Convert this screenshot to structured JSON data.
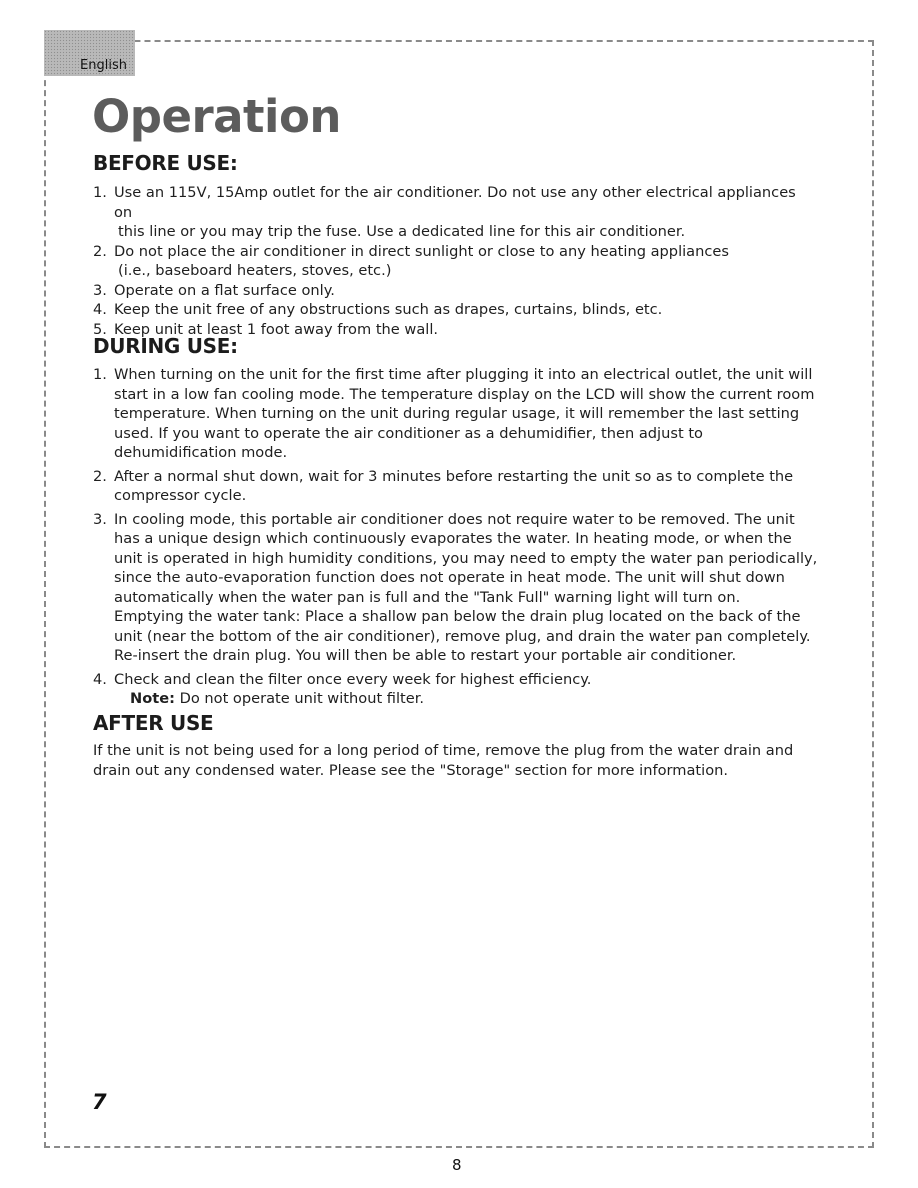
{
  "header": {
    "language_tab": "English",
    "title": "Operation"
  },
  "sections": {
    "before_use": {
      "heading": "BEFORE USE:",
      "items": [
        {
          "num": "1.",
          "line1": "Use an 115V, 15Amp outlet for the air conditioner. Do not use any other electrical appliances on",
          "line2": "this line or you may trip the fuse. Use a dedicated line for this air  conditioner."
        },
        {
          "num": "2.",
          "line1": "Do not place the air conditioner in direct sunlight or close to any heating appliances",
          "line2": "(i.e., baseboard heaters, stoves, etc.)"
        },
        {
          "num": "3.",
          "line1": "Operate on a flat surface only."
        },
        {
          "num": "4.",
          "line1": "Keep the unit free of any obstructions such as drapes, curtains, blinds, etc."
        },
        {
          "num": "5.",
          "line1": "Keep unit at least 1 foot away from the wall."
        }
      ]
    },
    "during_use": {
      "heading": "DURING USE:",
      "items": [
        {
          "num": "1.",
          "text": "When turning on the unit for the first time after plugging it into an electrical outlet, the unit will start in a low fan cooling mode. The temperature display on the LCD will show the current room temperature. When turning on the unit during regular usage, it will remember the last setting used. If you want to operate the air conditioner as a dehumidifier, then adjust to dehumidification mode."
        },
        {
          "num": "2.",
          "text": "After a normal shut down, wait for 3 minutes before restarting the unit so as to complete the compressor cycle."
        },
        {
          "num": "3.",
          "text": "In cooling mode, this portable air conditioner does not require water to be removed. The unit has a unique design which continuously evaporates the water. In heating mode, or when the unit is operated in high humidity conditions, you may need to empty the water pan periodically, since the auto-evaporation function does not operate in heat mode. The unit will shut down automatically when the water pan is full and the \"Tank Full\" warning light will turn on.",
          "text2": "Emptying the water tank: Place a shallow pan below the drain plug located on the back of the unit (near the bottom of the air conditioner), remove plug, and drain the water pan completely. Re-insert the drain plug. You will then be able to restart your portable air conditioner."
        },
        {
          "num": "4.",
          "text": "Check and clean the filter once every week for highest efficiency.",
          "note_label": "Note:",
          "note_text": " Do not operate unit without filter."
        }
      ]
    },
    "after_use": {
      "heading": "AFTER USE",
      "text": "If the unit is not being used for a long period of time, remove the plug from the water drain and drain out any condensed water. Please see the \"Storage\"  section for more  information."
    }
  },
  "footer": {
    "manual_page": "7",
    "pdf_page": "8"
  }
}
